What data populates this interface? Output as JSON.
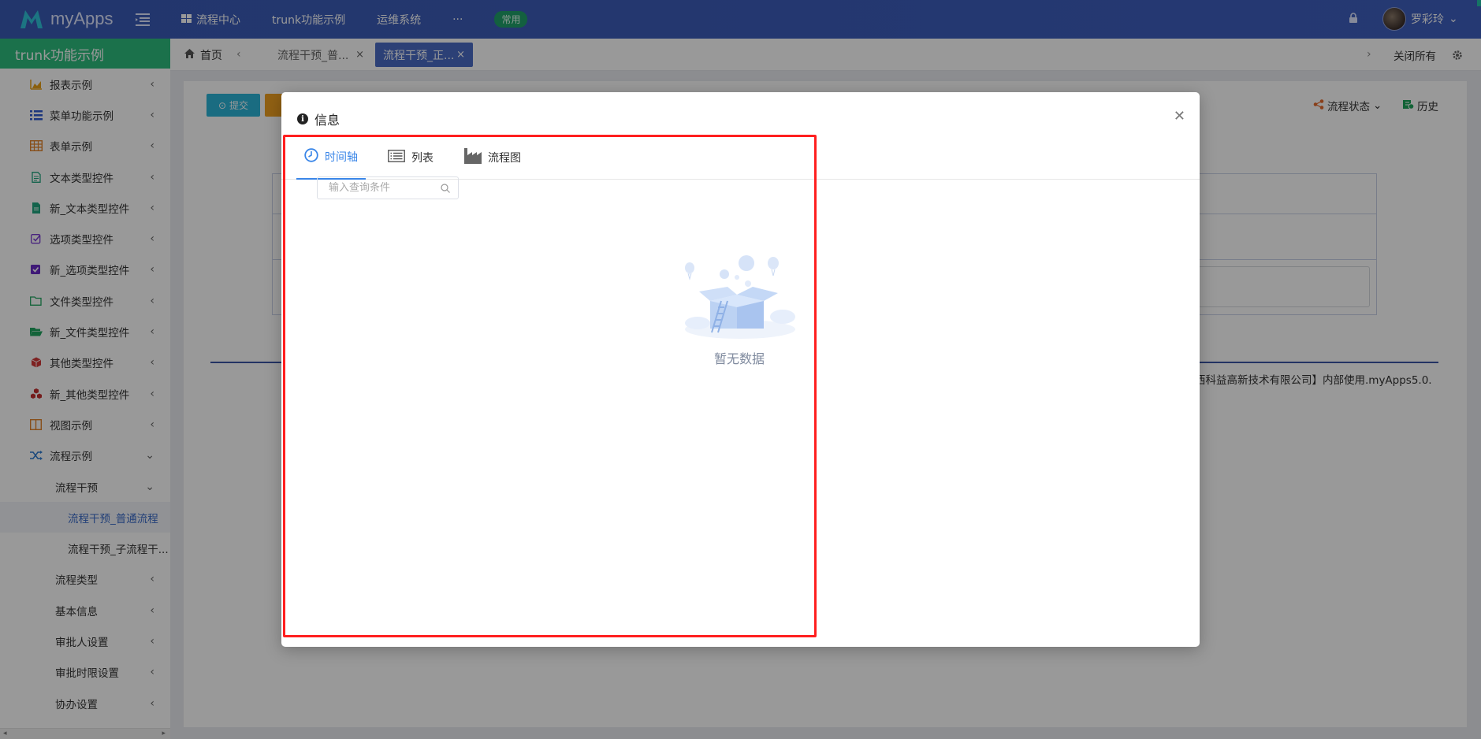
{
  "header": {
    "app_name": "myApps",
    "nav": [
      {
        "label": "流程中心"
      },
      {
        "label": "trunk功能示例"
      },
      {
        "label": "运维系统"
      },
      {
        "label": "···"
      }
    ],
    "pill_label": "常用",
    "user_name": "罗彩玲",
    "brand_color": "#3f5fc0"
  },
  "sidebar": {
    "title": "trunk功能示例",
    "items": [
      {
        "label": "报表示例",
        "icon": "area-chart-icon"
      },
      {
        "label": "菜单功能示例",
        "icon": "list-icon"
      },
      {
        "label": "表单示例",
        "icon": "table-icon"
      },
      {
        "label": "文本类型控件",
        "icon": "file-text-icon"
      },
      {
        "label": "新_文本类型控件",
        "icon": "file-icon"
      },
      {
        "label": "选项类型控件",
        "icon": "checkbox-outline-icon"
      },
      {
        "label": "新_选项类型控件",
        "icon": "checkbox-icon"
      },
      {
        "label": "文件类型控件",
        "icon": "folder-outline-icon"
      },
      {
        "label": "新_文件类型控件",
        "icon": "folder-open-icon"
      },
      {
        "label": "其他类型控件",
        "icon": "cube-icon"
      },
      {
        "label": "新_其他类型控件",
        "icon": "cubes-icon"
      },
      {
        "label": "视图示例",
        "icon": "columns-icon"
      },
      {
        "label": "流程示例",
        "icon": "random-icon"
      }
    ],
    "sub_group": "流程干预",
    "sub_items": [
      "流程干预_普通流程",
      "流程干预_子流程干..."
    ],
    "more_items": [
      "流程类型",
      "基本信息",
      "审批人设置",
      "审批时限设置",
      "协办设置"
    ]
  },
  "tabs_bar": {
    "home": "首页",
    "tabs": [
      {
        "label": "流程干预_普..."
      },
      {
        "label": "流程干预_正..."
      }
    ],
    "close_all": "关闭所有"
  },
  "background": {
    "submit_label": "提交",
    "flow_state_label": "流程状态",
    "history_label": "历史",
    "footer_text": "西科益高新技术有限公司】内部使用.myApps5.0."
  },
  "modal": {
    "title": "信息",
    "tabs": [
      {
        "label": "时间轴",
        "icon": "clock-icon"
      },
      {
        "label": "列表",
        "icon": "list-alt-icon"
      },
      {
        "label": "流程图",
        "icon": "factory-icon"
      }
    ],
    "search_placeholder": "输入查询条件",
    "empty_text": "暂无数据",
    "accent_color": "#3a86e8",
    "highlight_color": "#ff1f1f"
  }
}
